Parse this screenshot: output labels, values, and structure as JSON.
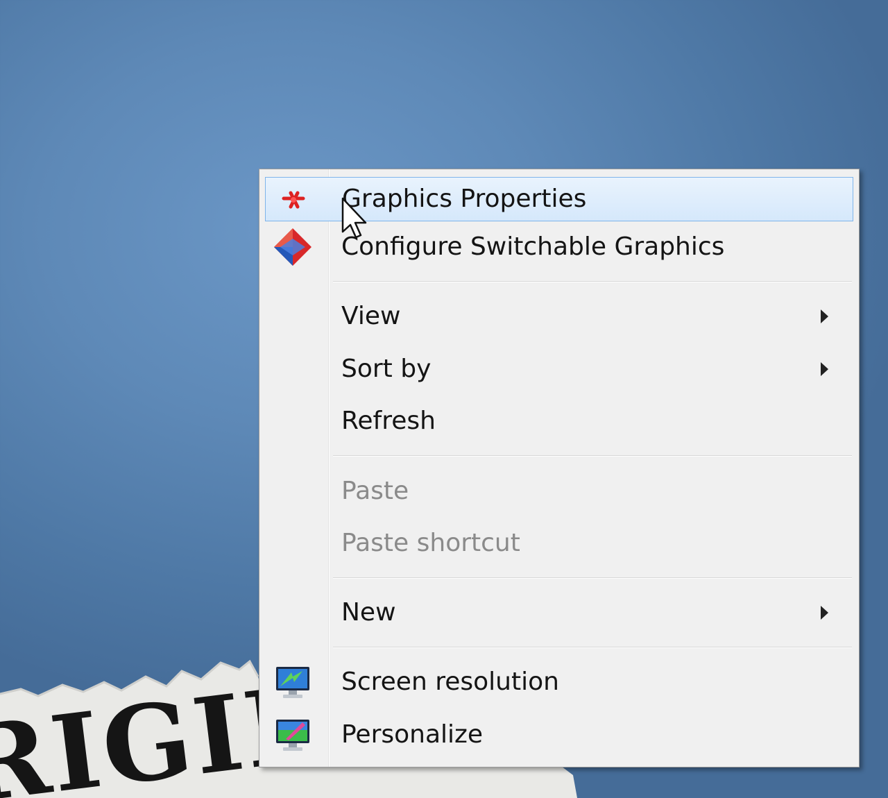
{
  "menu": {
    "items": [
      {
        "label": "Graphics Properties",
        "icon": "intel-graphics-icon",
        "highlighted": true,
        "enabled": true
      },
      {
        "label": "Configure Switchable Graphics",
        "icon": "amd-switchable-graphics-icon",
        "enabled": true
      },
      {
        "label": "View",
        "submenu": true,
        "enabled": true
      },
      {
        "label": "Sort by",
        "submenu": true,
        "enabled": true
      },
      {
        "label": "Refresh",
        "enabled": true
      },
      {
        "label": "Paste",
        "enabled": false
      },
      {
        "label": "Paste shortcut",
        "enabled": false
      },
      {
        "label": "New",
        "submenu": true,
        "enabled": true
      },
      {
        "label": "Screen resolution",
        "icon": "screen-resolution-icon",
        "enabled": true
      },
      {
        "label": "Personalize",
        "icon": "personalize-icon",
        "enabled": true
      }
    ]
  },
  "wallpaper": {
    "paper_text": "RIGINAL"
  },
  "colors": {
    "desktop_background": "#5e89b7",
    "menu_background": "#f0f0f0",
    "highlight_border": "#7eb4ea",
    "disabled_text": "#8a8a8a"
  }
}
